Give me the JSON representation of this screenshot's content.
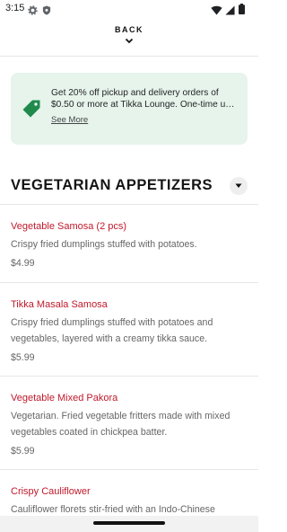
{
  "status_bar": {
    "time": "3:15"
  },
  "header": {
    "back_label": "BACK"
  },
  "promo": {
    "line1": "Get 20% off pickup and delivery orders of",
    "line2": "$0.50 or more at Tikka Lounge. One-time u…",
    "link": "See More",
    "accent_color": "#1f8a4c"
  },
  "section": {
    "title": "VEGETARIAN APPETIZERS"
  },
  "menu_items": [
    {
      "name": "Vegetable Samosa (2 pcs)",
      "description": "Crispy fried dumplings stuffed with potatoes.",
      "price": "$4.99"
    },
    {
      "name": "Tikka Masala Samosa",
      "description": "Crispy fried dumplings stuffed with potatoes and vegetables, layered with a creamy tikka sauce.",
      "price": "$5.99"
    },
    {
      "name": "Vegetable Mixed Pakora",
      "description": "Vegetarian. Fried vegetable fritters made with mixed vegetables coated in chickpea batter.",
      "price": "$5.99"
    },
    {
      "name": "Crispy Cauliflower",
      "description": "Cauliflower florets stir-fried with an Indo-Chinese",
      "price": ""
    }
  ],
  "colors": {
    "item_name": "#c0192b",
    "promo_bg": "#e6f4ec"
  }
}
